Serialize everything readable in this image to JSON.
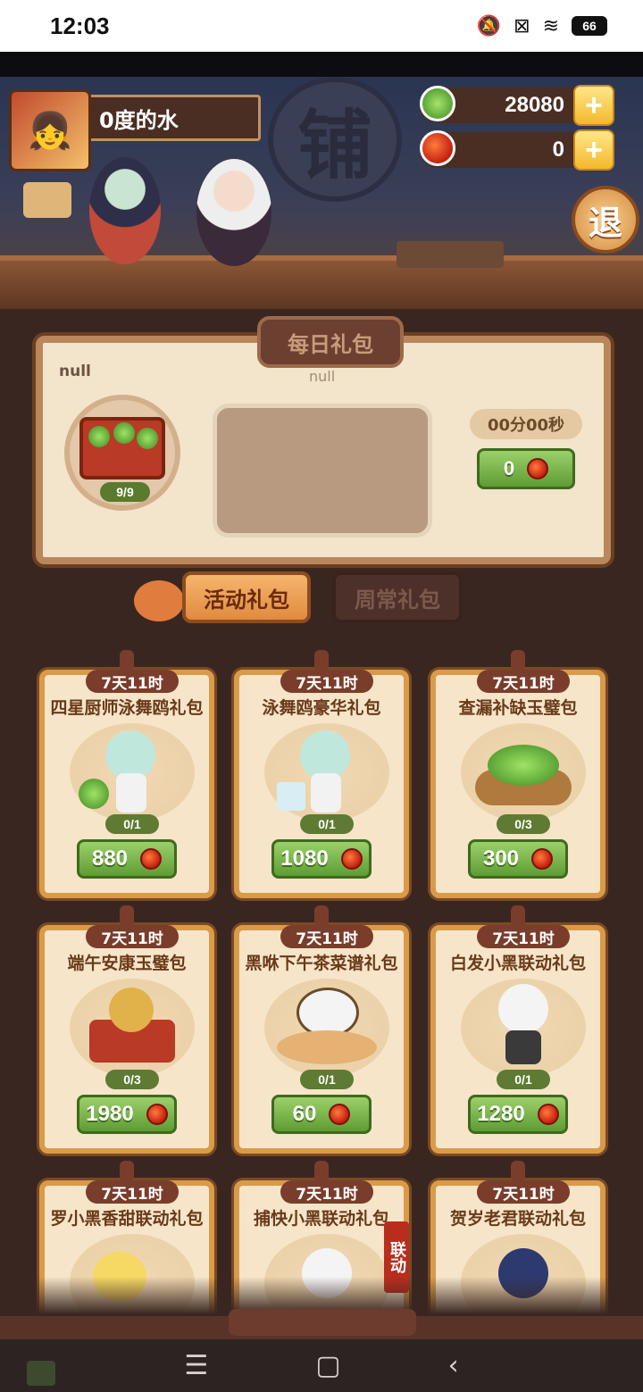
{
  "status_bar": {
    "time": "12:03",
    "battery": "66",
    "icons": [
      "mute-icon",
      "close-box-icon",
      "wifi-icon",
      "battery-icon"
    ]
  },
  "header": {
    "shop_sign": "铺",
    "player_name": "0度的水",
    "jade_amount": "28080",
    "apple_amount": "0",
    "plus_label": "+",
    "exit_label": "退"
  },
  "daily_pack": {
    "title": "每日礼包",
    "label_left": "null",
    "label_center": "null",
    "chest_count": "9/9",
    "timer": "00分00秒",
    "price": "0"
  },
  "tabs": [
    {
      "label": "活动礼包",
      "active": true
    },
    {
      "label": "周常礼包",
      "active": false
    }
  ],
  "packs": [
    {
      "time": "7天11时",
      "title": "四星厨师泳舞鸥礼包",
      "count": "0/1",
      "price": "880"
    },
    {
      "time": "7天11时",
      "title": "泳舞鸥豪华礼包",
      "count": "0/1",
      "price": "1080"
    },
    {
      "time": "7天11时",
      "title": "查漏补缺玉璧包",
      "count": "0/3",
      "price": "300"
    },
    {
      "time": "7天11时",
      "title": "端午安康玉璧包",
      "count": "0/3",
      "price": "1980"
    },
    {
      "time": "7天11时",
      "title": "黑咻下午茶菜谱礼包",
      "count": "0/1",
      "price": "60"
    },
    {
      "time": "7天11时",
      "title": "白发小黑联动礼包",
      "count": "0/1",
      "price": "1280"
    },
    {
      "time": "7天11时",
      "title": "罗小黑香甜联动礼包"
    },
    {
      "time": "7天11时",
      "title": "捕快小黑联动礼包",
      "badge": "联动"
    },
    {
      "time": "7天11时",
      "title": "贺岁老君联动礼包"
    }
  ],
  "navbar": {
    "menu": "☰",
    "home": "▢",
    "back": "‹"
  },
  "colors": {
    "panel_bg": "#3a2621",
    "card_bg": "#f6e5c8",
    "card_border": "#d99b4a",
    "button_green": "#7db850",
    "tag_brown": "#7a3d2b"
  }
}
